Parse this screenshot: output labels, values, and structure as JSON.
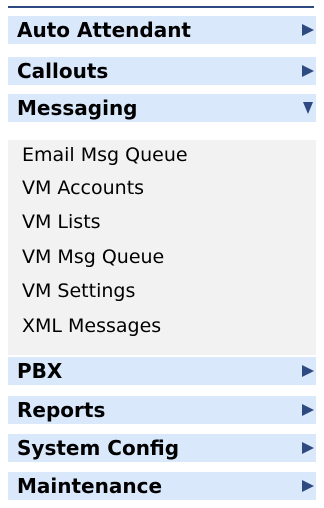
{
  "menu": {
    "auto_attendant": "Auto Attendant",
    "callouts": "Callouts",
    "messaging": "Messaging",
    "messaging_items": [
      "Email Msg Queue",
      "VM Accounts",
      "VM Lists",
      "VM Msg Queue",
      "VM Settings",
      "XML Messages"
    ],
    "pbx": "PBX",
    "reports": "Reports",
    "system_config": "System Config",
    "maintenance": "Maintenance"
  },
  "colors": {
    "header_bg": "#d9e8fb",
    "submenu_bg": "#f2f2f2",
    "arrow": "#2e4a80"
  },
  "icons": {
    "collapsed": "arrow-right-icon",
    "expanded": "arrow-down-icon"
  }
}
